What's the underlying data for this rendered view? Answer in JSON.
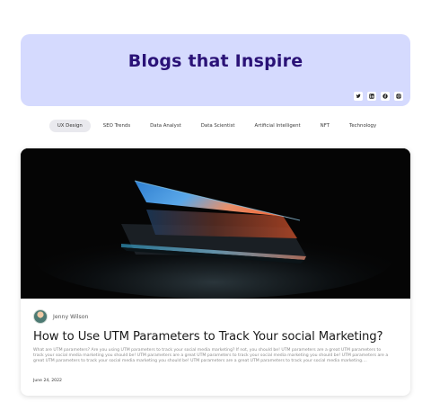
{
  "hero": {
    "title": "Blogs that Inspire",
    "background": "#d5dafe",
    "title_color": "#2a1277",
    "socials": [
      {
        "icon": "twitter-icon",
        "label": "Twitter"
      },
      {
        "icon": "linkedin-icon",
        "label": "LinkedIn"
      },
      {
        "icon": "facebook-icon",
        "label": "Facebook"
      },
      {
        "icon": "instagram-icon",
        "label": "Instagram"
      }
    ]
  },
  "categories": {
    "active": "UX Design",
    "items": [
      "UX Design",
      "SEO Trends",
      "Data Analyst",
      "Data Scientist",
      "Artificial Intelligent",
      "NFT",
      "Technology"
    ]
  },
  "post": {
    "image": "laptop-glow-image",
    "author": "Jenny Wilson",
    "title": "How to Use UTM Parameters to Track Your social Marketing?",
    "excerpt": "What are UTM parameters? Are you using UTM parameters to track your social media marketing? If not, you should be! UTM parameters are a great UTM parameters to track your social media marketing you should be! UTM parameters are a great UTM parameters to track your social media marketing you should be! UTM parameters are a great UTM parameters to track your social media marketing you should be! UTM parameters are a great UTM parameters to track your social media marketing....",
    "date": "June 24, 2022"
  }
}
